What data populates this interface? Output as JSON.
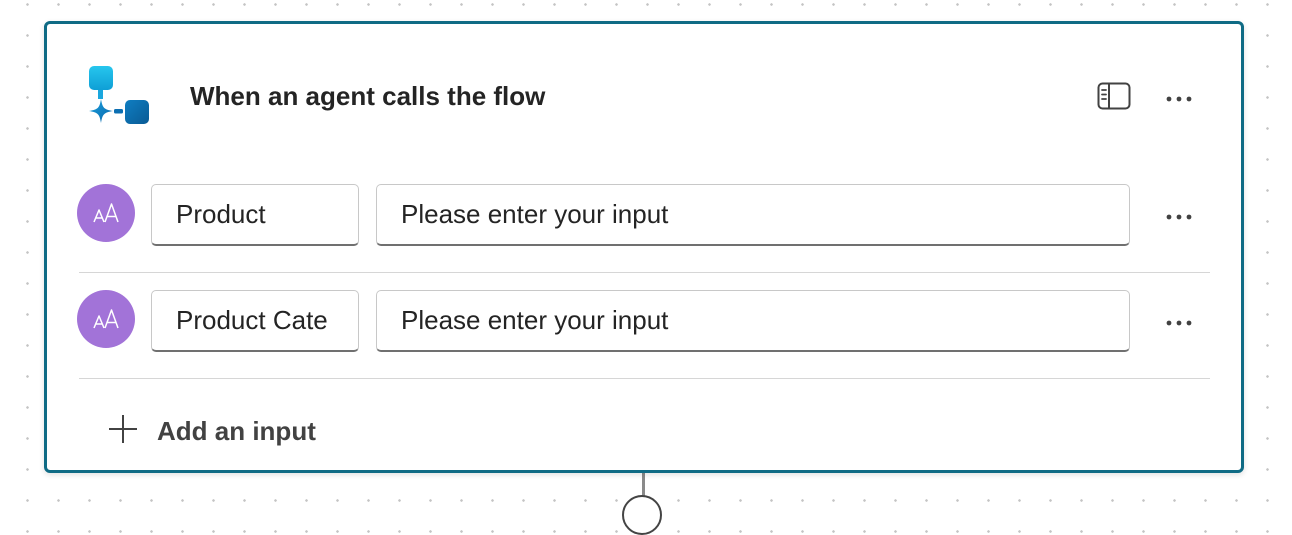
{
  "trigger": {
    "title": "When an agent calls the flow",
    "icon": "agent-flow-trigger-icon",
    "accent_color": "#0f6b85"
  },
  "header_actions": {
    "panel_icon": "side-panel-icon",
    "more_icon": "more-options-icon"
  },
  "inputs": [
    {
      "type_icon": "text-type-icon",
      "type_glyph": "AA",
      "name": "Product",
      "description_placeholder": "Please enter your input"
    },
    {
      "type_icon": "text-type-icon",
      "type_glyph": "AA",
      "name": "Product Cate",
      "description_placeholder": "Please enter your input"
    }
  ],
  "add_input": {
    "label": "Add an input",
    "icon": "plus-icon"
  },
  "colors": {
    "avatar": "#a273d8",
    "border": "#0f6b85"
  }
}
